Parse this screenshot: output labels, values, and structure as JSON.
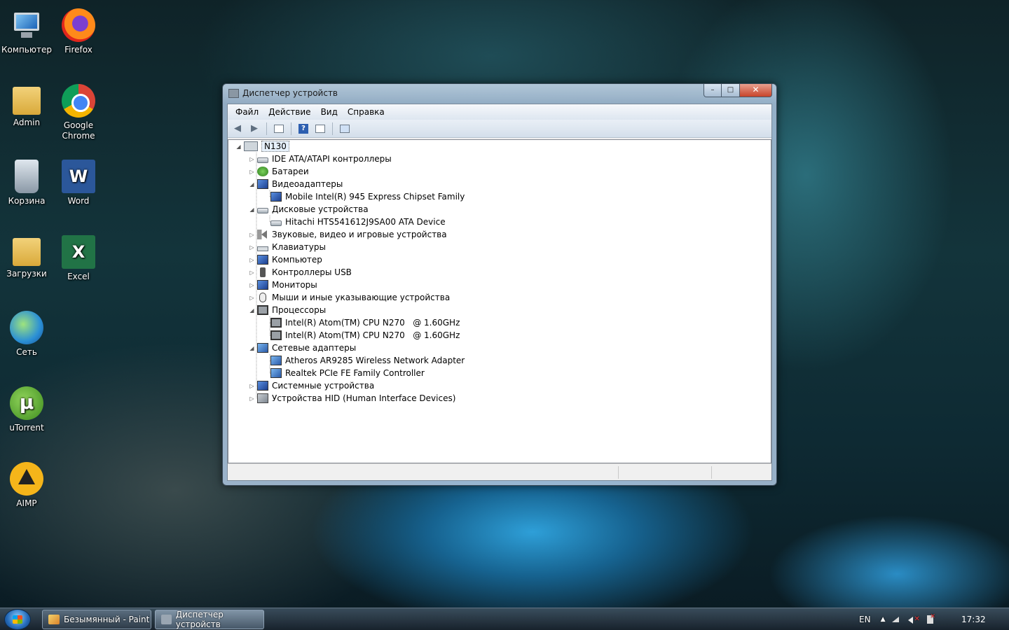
{
  "desktop": {
    "icons": [
      {
        "label": "Компьютер"
      },
      {
        "label": "Firefox"
      },
      {
        "label": "Admin"
      },
      {
        "label": "Google Chrome"
      },
      {
        "label": "Корзина"
      },
      {
        "label": "Word"
      },
      {
        "label": "Загрузки"
      },
      {
        "label": "Excel"
      },
      {
        "label": "Сеть"
      },
      {
        "label": "uTorrent"
      },
      {
        "label": "AIMP"
      }
    ]
  },
  "window": {
    "title": "Диспетчер устройств",
    "menu": [
      "Файл",
      "Действие",
      "Вид",
      "Справка"
    ],
    "tree": {
      "root": "N130",
      "nodes": [
        {
          "label": "IDE ATA/ATAPI контроллеры",
          "expanded": false,
          "icon": "drive-icon"
        },
        {
          "label": "Батареи",
          "expanded": false,
          "icon": "battery-icon"
        },
        {
          "label": "Видеоадаптеры",
          "expanded": true,
          "icon": "monitor-icon",
          "children": [
            "Mobile Intel(R) 945 Express Chipset Family"
          ]
        },
        {
          "label": "Дисковые устройства",
          "expanded": true,
          "icon": "drive-icon",
          "children": [
            "Hitachi HTS541612J9SA00 ATA Device"
          ]
        },
        {
          "label": "Звуковые, видео и игровые устройства",
          "expanded": false,
          "icon": "speaker-icon"
        },
        {
          "label": "Клавиатуры",
          "expanded": false,
          "icon": "keyboard-icon"
        },
        {
          "label": "Компьютер",
          "expanded": false,
          "icon": "monitor-icon"
        },
        {
          "label": "Контроллеры USB",
          "expanded": false,
          "icon": "usb-icon"
        },
        {
          "label": "Мониторы",
          "expanded": false,
          "icon": "monitor-icon"
        },
        {
          "label": "Мыши и иные указывающие устройства",
          "expanded": false,
          "icon": "mouse-icon"
        },
        {
          "label": "Процессоры",
          "expanded": true,
          "icon": "cpu-icon",
          "children": [
            "Intel(R) Atom(TM) CPU N270   @ 1.60GHz",
            "Intel(R) Atom(TM) CPU N270   @ 1.60GHz"
          ]
        },
        {
          "label": "Сетевые адаптеры",
          "expanded": true,
          "icon": "network-adapter-icon",
          "children": [
            "Atheros AR9285 Wireless Network Adapter",
            "Realtek PCIe FE Family Controller"
          ]
        },
        {
          "label": "Системные устройства",
          "expanded": false,
          "icon": "monitor-icon"
        },
        {
          "label": "Устройства HID (Human Interface Devices)",
          "expanded": false,
          "icon": "hid-icon"
        }
      ]
    }
  },
  "taskbar": {
    "buttons": [
      {
        "label": "Безымянный - Paint",
        "active": false
      },
      {
        "label": "Диспетчер устройств",
        "active": true
      }
    ],
    "language": "EN",
    "time": "17:32"
  }
}
